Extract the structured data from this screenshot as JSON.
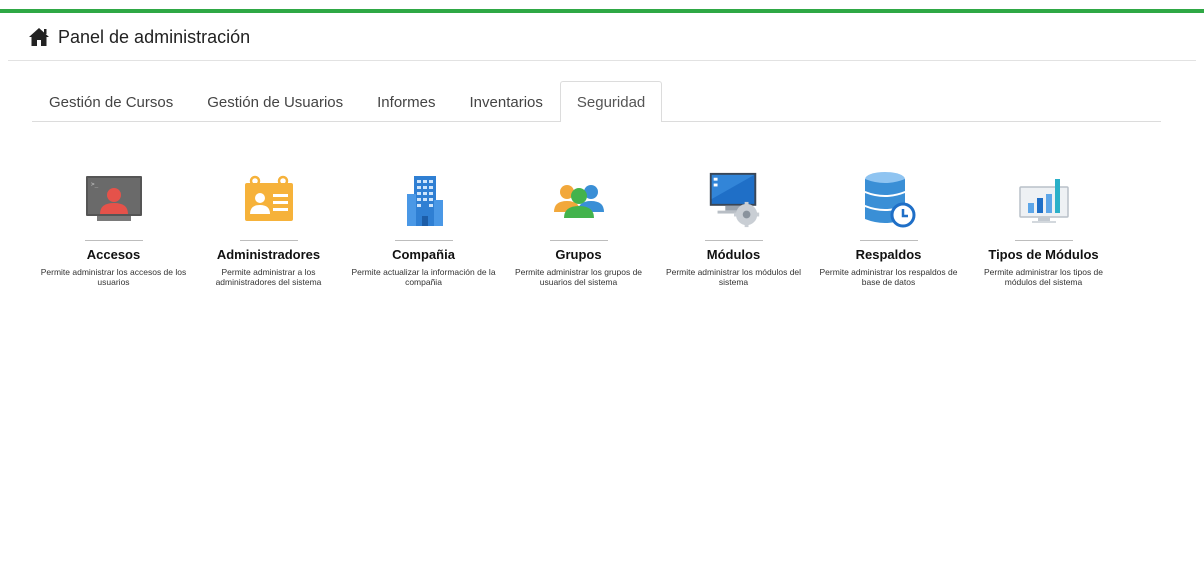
{
  "header": {
    "title": "Panel de administración",
    "icon": "home-icon",
    "accent_color": "#2fa845"
  },
  "tabs": [
    {
      "label": "Gestión de Cursos",
      "active": false
    },
    {
      "label": "Gestión de Usuarios",
      "active": false
    },
    {
      "label": "Informes",
      "active": false
    },
    {
      "label": "Inventarios",
      "active": false
    },
    {
      "label": "Seguridad",
      "active": true
    }
  ],
  "modules": [
    {
      "title": "Accesos",
      "desc": "Permite administrar los accesos de los usuarios",
      "icon": "user-terminal-icon"
    },
    {
      "title": "Administradores",
      "desc": "Permite administrar a los administradores del sistema",
      "icon": "id-card-icon"
    },
    {
      "title": "Compañia",
      "desc": "Permite actualizar la información de la compañia",
      "icon": "building-icon"
    },
    {
      "title": "Grupos",
      "desc": "Permite administrar los grupos de usuarios del sistema",
      "icon": "user-group-icon"
    },
    {
      "title": "Módulos",
      "desc": "Permite administrar los módulos del sistema",
      "icon": "monitor-gear-icon"
    },
    {
      "title": "Respaldos",
      "desc": "Permite administrar los respaldos de base de datos",
      "icon": "database-clock-icon"
    },
    {
      "title": "Tipos de Módulos",
      "desc": "Permite administrar los tipos de módulos del sistema",
      "icon": "bar-chart-monitor-icon"
    }
  ]
}
